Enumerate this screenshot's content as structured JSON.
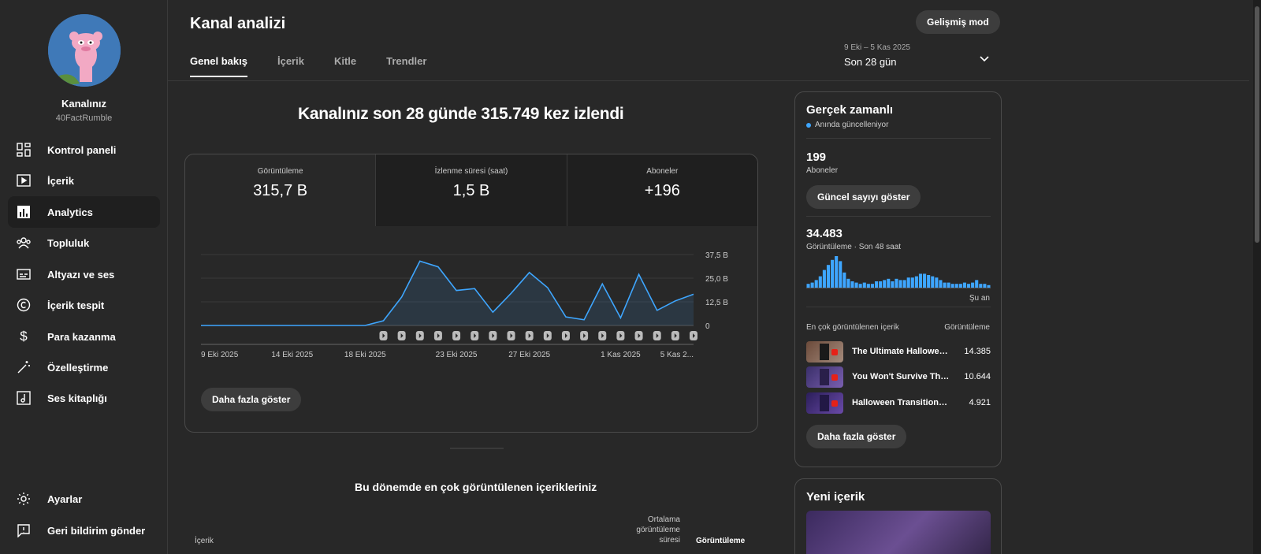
{
  "sidebar": {
    "channel_name": "Kanalınız",
    "channel_handle": "40FactRumble",
    "items": [
      {
        "label": "Kontrol paneli",
        "icon": "dashboard-icon"
      },
      {
        "label": "İçerik",
        "icon": "content-icon"
      },
      {
        "label": "Analytics",
        "icon": "analytics-icon",
        "active": true
      },
      {
        "label": "Topluluk",
        "icon": "community-icon"
      },
      {
        "label": "Altyazı ve ses",
        "icon": "subtitles-icon"
      },
      {
        "label": "İçerik tespit",
        "icon": "copyright-icon"
      },
      {
        "label": "Para kazanma",
        "icon": "dollar-icon"
      },
      {
        "label": "Özelleştirme",
        "icon": "magic-wand-icon"
      },
      {
        "label": "Ses kitaplığı",
        "icon": "audio-library-icon"
      }
    ],
    "bottom_items": [
      {
        "label": "Ayarlar",
        "icon": "gear-icon"
      },
      {
        "label": "Geri bildirim gönder",
        "icon": "feedback-icon"
      }
    ]
  },
  "header": {
    "title": "Kanal analizi",
    "advanced_mode": "Gelişmiş mod",
    "tabs": [
      "Genel bakış",
      "İçerik",
      "Kitle",
      "Trendler"
    ],
    "date_range_small": "9 Eki – 5 Kas 2025",
    "date_range_label": "Son 28 gün"
  },
  "overview": {
    "headline": "Kanalınız son 28 günde 315.749 kez izlendi",
    "metrics": [
      {
        "label": "Görüntüleme",
        "value": "315,7 B"
      },
      {
        "label": "İzlenme süresi (saat)",
        "value": "1,5 B"
      },
      {
        "label": "Aboneler",
        "value": "+196"
      }
    ],
    "show_more": "Daha fazla göster"
  },
  "chart_data": {
    "type": "area",
    "x": [
      "9 Eki 2025",
      "10 Eki",
      "11 Eki",
      "12 Eki",
      "13 Eki",
      "14 Eki 2025",
      "15 Eki",
      "16 Eki",
      "17 Eki",
      "18 Eki 2025",
      "19 Eki",
      "20 Eki",
      "21 Eki",
      "22 Eki",
      "23 Eki 2025",
      "24 Eki",
      "25 Eki",
      "26 Eki",
      "27 Eki 2025",
      "28 Eki",
      "29 Eki",
      "30 Eki",
      "31 Eki",
      "1 Kas 2025",
      "2 Kas",
      "3 Kas",
      "4 Kas",
      "5 Kas 2025"
    ],
    "series": [
      {
        "values": [
          0,
          0,
          0,
          0,
          0,
          0,
          0,
          0,
          0,
          0,
          2.5,
          15,
          34,
          31,
          18.5,
          19.5,
          7,
          17,
          28,
          20,
          4.5,
          3,
          22,
          4,
          27,
          8,
          13,
          16.5
        ]
      }
    ],
    "tick_labels_x": [
      "9 Eki 2025",
      "14 Eki 2025",
      "18 Eki 2025",
      "23 Eki 2025",
      "27 Eki 2025",
      "1 Kas 2025",
      "5 Kas 2..."
    ],
    "tick_labels_y": [
      "0",
      "12,5 B",
      "25,0 B",
      "37,5 B"
    ],
    "ylim": [
      0,
      37.5
    ],
    "grid": true,
    "color": "#3ea6ff"
  },
  "realtime": {
    "title": "Gerçek zamanlı",
    "live_label": "Anında güncelleniyor",
    "subscribers": "199",
    "subscribers_label": "Aboneler",
    "show_count_btn": "Güncel sayıyı göster",
    "views": "34.483",
    "views_label": "Görüntüleme · Son 48 saat",
    "bars": [
      3,
      4,
      6,
      9,
      14,
      18,
      22,
      25,
      21,
      12,
      7,
      5,
      4,
      3,
      4,
      3,
      3,
      5,
      5,
      6,
      7,
      5,
      7,
      6,
      6,
      8,
      8,
      9,
      11,
      11,
      10,
      9,
      8,
      6,
      4,
      4,
      3,
      3,
      3,
      4,
      3,
      4,
      6,
      3,
      3,
      2
    ],
    "now_label": "Şu an",
    "top_header_left": "En çok görüntülenen içerik",
    "top_header_right": "Görüntüleme",
    "top_items": [
      {
        "title": "The Ultimate Halloween...",
        "views": "14.385"
      },
      {
        "title": "You Won't Survive Thes...",
        "views": "10.644"
      },
      {
        "title": "Halloween Transitions Ti...",
        "views": "4.921"
      }
    ],
    "show_more": "Daha fazla göster"
  },
  "new_content": {
    "title": "Yeni içerik"
  },
  "top_content": {
    "title": "Bu dönemde en çok görüntülenen içerikleriniz",
    "col_content": "İçerik",
    "col_avg_1": "Ortalama",
    "col_avg_2": "görüntüleme",
    "col_avg_3": "süresi",
    "col_views": "Görüntüleme"
  }
}
